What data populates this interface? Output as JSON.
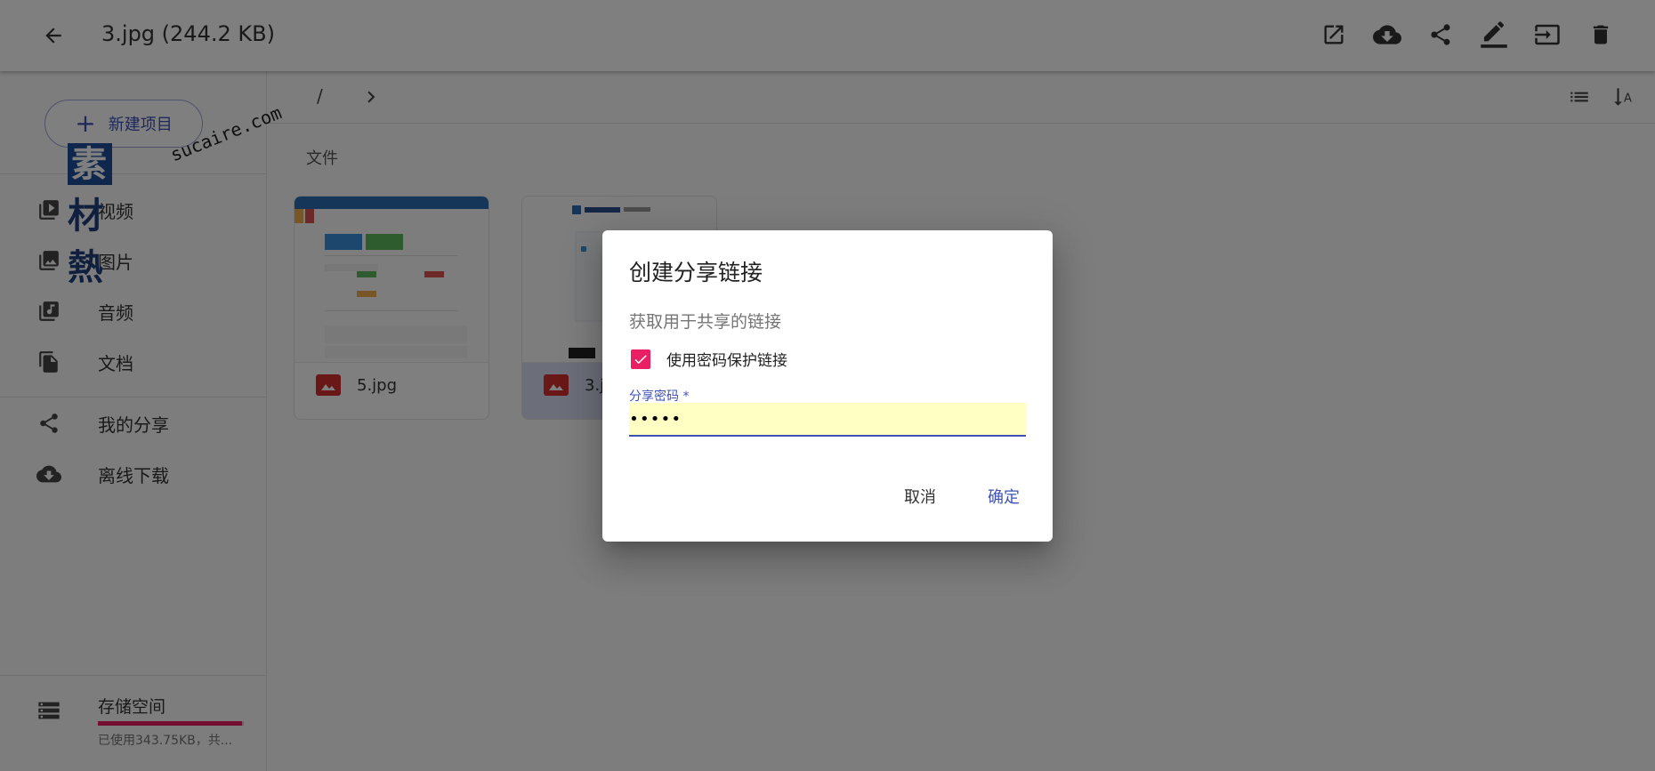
{
  "header": {
    "back_icon": "arrow-left-icon",
    "title": "3.jpg (244.2 KB)",
    "actions": [
      {
        "name": "open-external-icon",
        "label": "open"
      },
      {
        "name": "cloud-download-icon",
        "label": "download"
      },
      {
        "name": "share-icon",
        "label": "share"
      },
      {
        "name": "edit-icon",
        "label": "rename"
      },
      {
        "name": "move-icon",
        "label": "move"
      },
      {
        "name": "delete-icon",
        "label": "delete"
      }
    ]
  },
  "sidebar": {
    "new_button": "新建项目",
    "items": [
      {
        "label": "视频",
        "icon": "video-library-icon"
      },
      {
        "label": "图片",
        "icon": "photo-library-icon"
      },
      {
        "label": "音频",
        "icon": "music-library-icon"
      },
      {
        "label": "文档",
        "icon": "document-icon"
      },
      {
        "label": "我的分享",
        "icon": "share-icon"
      },
      {
        "label": "离线下载",
        "icon": "cloud-download-icon"
      }
    ],
    "storage": {
      "label": "存储空间",
      "usage": "已使用343.75KB，共...",
      "used_fraction": 0.99
    }
  },
  "watermark": {
    "cn": "素材熱",
    "en": "sucaire.com"
  },
  "main": {
    "breadcrumb_root": "/",
    "section_title": "文件",
    "files": [
      {
        "name": "5.jpg",
        "selected": false
      },
      {
        "name": "3.jpg",
        "selected": true
      }
    ]
  },
  "dialog": {
    "title": "创建分享链接",
    "description": "获取用于共享的链接",
    "checkbox_label": "使用密码保护链接",
    "checkbox_checked": true,
    "password_label": "分享密码 *",
    "password_value": "•••••",
    "cancel": "取消",
    "ok": "确定"
  },
  "colors": {
    "primary": "#3f51b5",
    "accent": "#e91e63",
    "autofill": "#ffffc4"
  }
}
